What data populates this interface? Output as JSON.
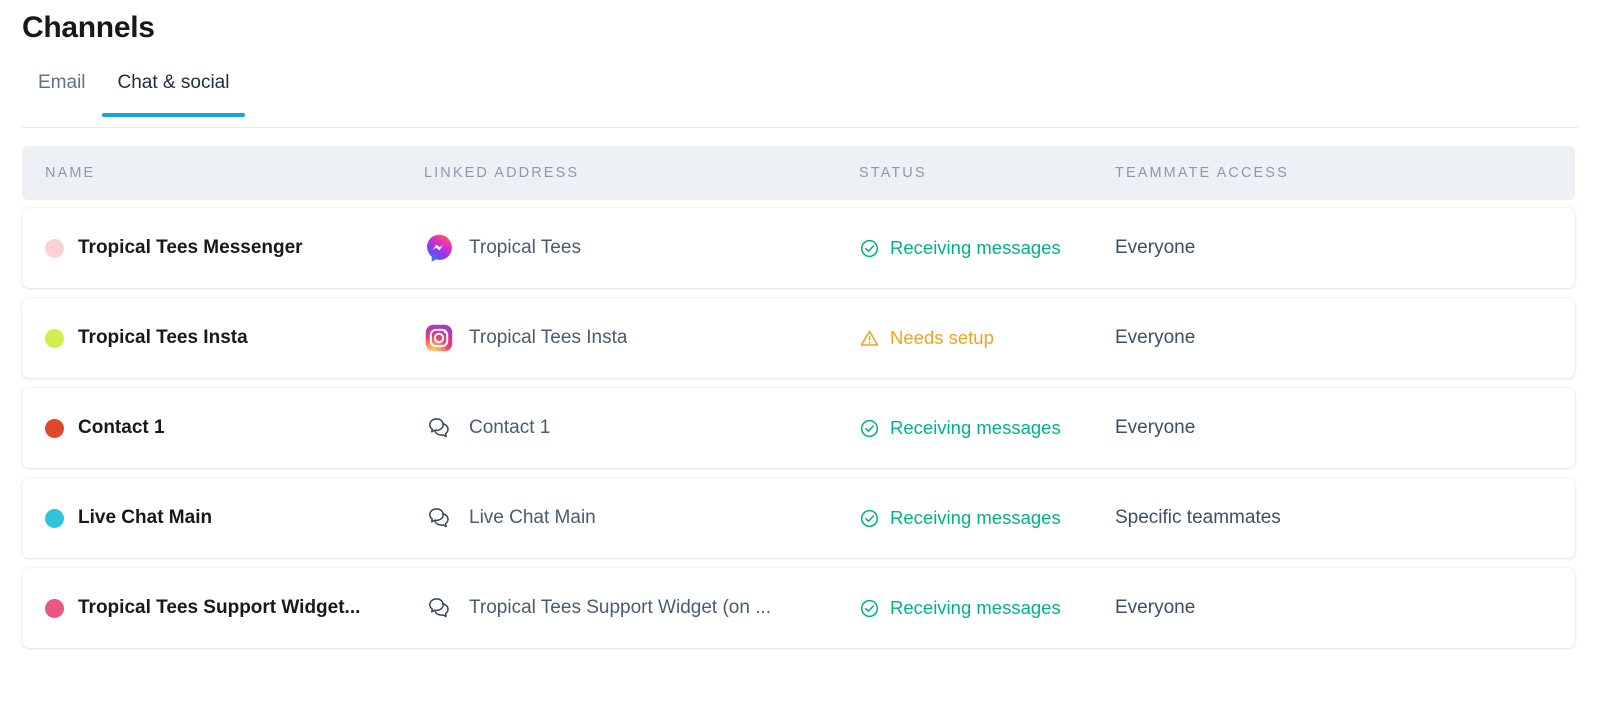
{
  "page": {
    "title": "Channels"
  },
  "tabs": [
    {
      "label": "Email",
      "active": false
    },
    {
      "label": "Chat & social",
      "active": true
    }
  ],
  "table": {
    "columns": [
      {
        "key": "name",
        "label": "Name"
      },
      {
        "key": "address",
        "label": "Linked address"
      },
      {
        "key": "status",
        "label": "Status"
      },
      {
        "key": "access",
        "label": "Teammate access"
      }
    ],
    "rows": [
      {
        "dot_color": "#fad2d6",
        "name": "Tropical Tees Messenger",
        "icon": "messenger-icon",
        "address": "Tropical Tees",
        "status": "Receiving messages",
        "status_kind": "ok",
        "status_icon": "check-circle-icon",
        "access": "Everyone"
      },
      {
        "dot_color": "#cfef4e",
        "name": "Tropical Tees Insta",
        "icon": "instagram-icon",
        "address": "Tropical Tees Insta",
        "status": "Needs setup",
        "status_kind": "warn",
        "status_icon": "warning-triangle-icon",
        "access": "Everyone"
      },
      {
        "dot_color": "#dc4a28",
        "name": "Contact 1",
        "icon": "chat-bubbles-icon",
        "address": "Contact 1",
        "status": "Receiving messages",
        "status_kind": "ok",
        "status_icon": "check-circle-icon",
        "access": "Everyone"
      },
      {
        "dot_color": "#31c3dd",
        "name": "Live Chat Main",
        "icon": "chat-bubbles-icon",
        "address": "Live Chat Main",
        "status": "Receiving messages",
        "status_kind": "ok",
        "status_icon": "check-circle-icon",
        "access": "Specific teammates"
      },
      {
        "dot_color": "#ed5682",
        "name": "Tropical Tees Support Widget...",
        "icon": "chat-bubbles-icon",
        "address": "Tropical Tees Support Widget (on ...",
        "status": "Receiving messages",
        "status_kind": "ok",
        "status_icon": "check-circle-icon",
        "access": "Everyone"
      }
    ]
  },
  "colors": {
    "tab_active_underline": "#0fa3e8",
    "status_ok": "#00b289",
    "status_warn": "#f0a125",
    "header_bg": "#edf0f5",
    "header_text": "#8b99ab"
  }
}
